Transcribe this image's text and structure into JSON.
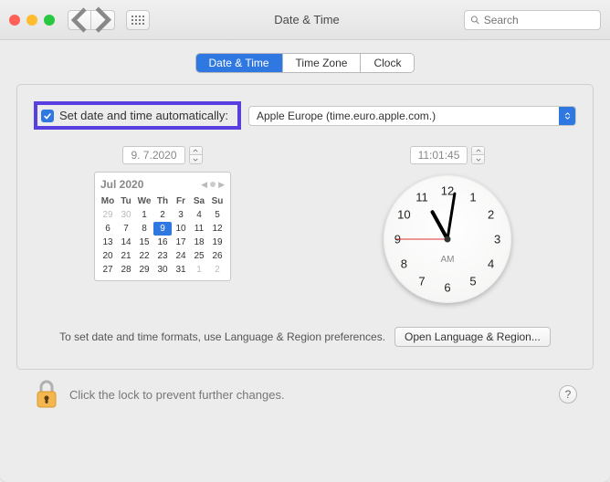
{
  "window": {
    "title": "Date & Time",
    "search_placeholder": "Search"
  },
  "tabs": [
    {
      "label": "Date & Time",
      "active": true
    },
    {
      "label": "Time Zone",
      "active": false
    },
    {
      "label": "Clock",
      "active": false
    }
  ],
  "auto": {
    "checkbox_label": "Set date and time automatically:",
    "checked": true,
    "ntp_server": "Apple Europe (time.euro.apple.com.)"
  },
  "date_field": "9.  7.2020",
  "time_field": "11:01:45",
  "calendar": {
    "title": "Jul 2020",
    "dow": [
      "Mo",
      "Tu",
      "We",
      "Th",
      "Fr",
      "Sa",
      "Su"
    ],
    "weeks": [
      [
        {
          "d": 29,
          "o": true
        },
        {
          "d": 30,
          "o": true
        },
        {
          "d": 1
        },
        {
          "d": 2
        },
        {
          "d": 3
        },
        {
          "d": 4
        },
        {
          "d": 5
        }
      ],
      [
        {
          "d": 6
        },
        {
          "d": 7
        },
        {
          "d": 8
        },
        {
          "d": 9,
          "sel": true
        },
        {
          "d": 10
        },
        {
          "d": 11
        },
        {
          "d": 12
        }
      ],
      [
        {
          "d": 13
        },
        {
          "d": 14
        },
        {
          "d": 15
        },
        {
          "d": 16
        },
        {
          "d": 17
        },
        {
          "d": 18
        },
        {
          "d": 19
        }
      ],
      [
        {
          "d": 20
        },
        {
          "d": 21
        },
        {
          "d": 22
        },
        {
          "d": 23
        },
        {
          "d": 24
        },
        {
          "d": 25
        },
        {
          "d": 26
        }
      ],
      [
        {
          "d": 27
        },
        {
          "d": 28
        },
        {
          "d": 29
        },
        {
          "d": 30
        },
        {
          "d": 31
        },
        {
          "d": 1,
          "o": true
        },
        {
          "d": 2,
          "o": true
        }
      ]
    ]
  },
  "clock": {
    "ampm": "AM",
    "numbers": {
      "12": "12",
      "1": "1",
      "2": "2",
      "3": "3",
      "4": "4",
      "5": "5",
      "6": "6",
      "7": "7",
      "8": "8",
      "9": "9",
      "10": "10",
      "11": "11"
    }
  },
  "format": {
    "hint": "To set date and time formats, use Language & Region preferences.",
    "button": "Open Language & Region..."
  },
  "lock": {
    "text": "Click the lock to prevent further changes."
  },
  "help": "?"
}
